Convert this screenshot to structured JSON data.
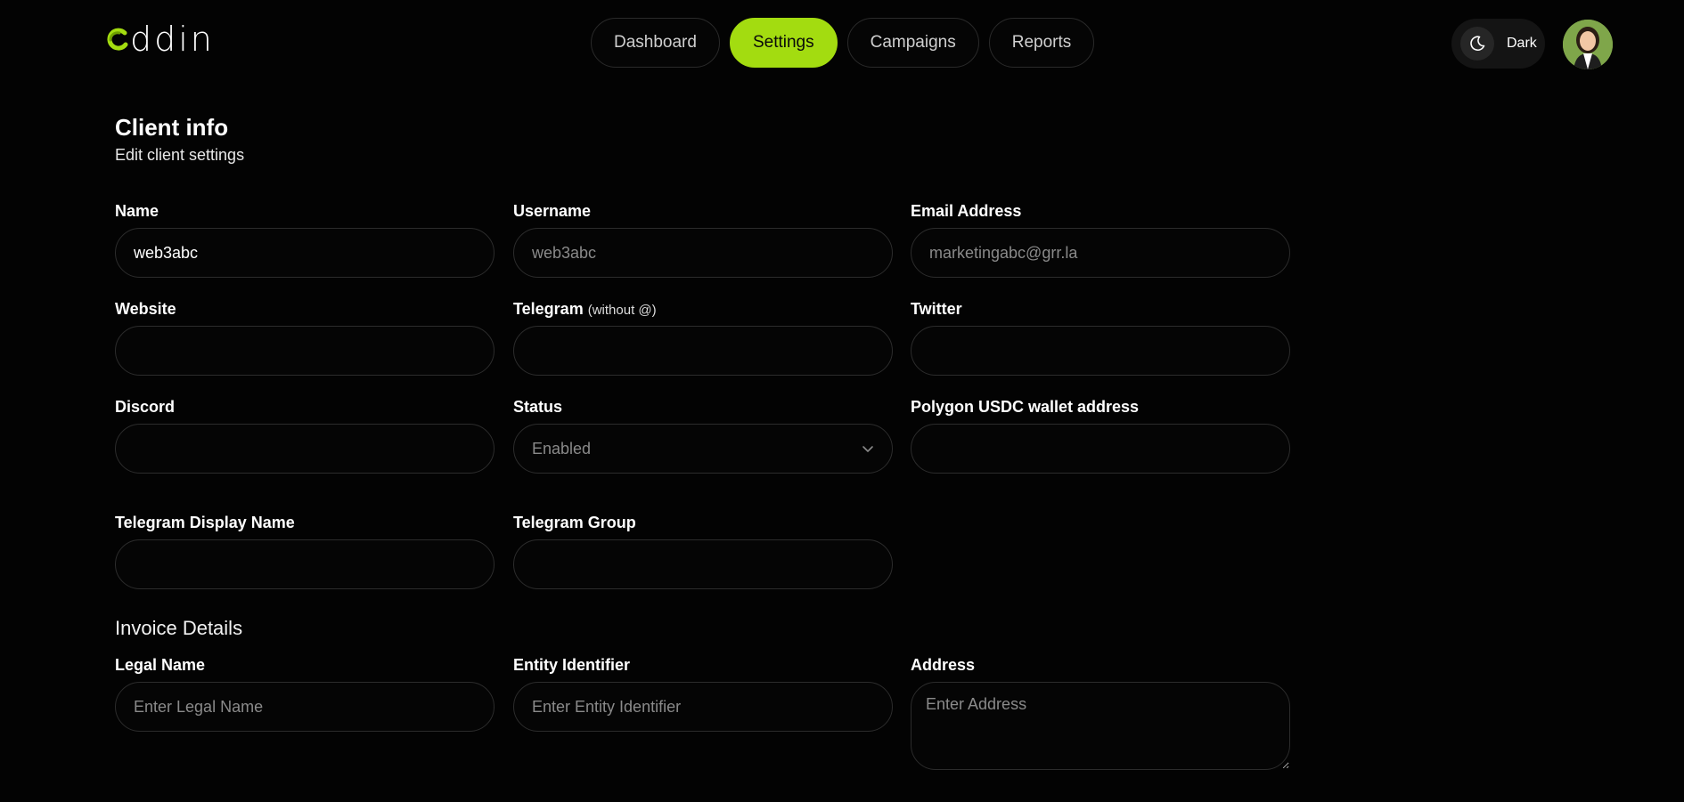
{
  "header": {
    "logo_text": "ddin",
    "nav": [
      {
        "label": "Dashboard",
        "active": false
      },
      {
        "label": "Settings",
        "active": true
      },
      {
        "label": "Campaigns",
        "active": false
      },
      {
        "label": "Reports",
        "active": false
      }
    ],
    "theme_label": "Dark",
    "theme_icon": "moon-icon",
    "accent_color": "#a3dc10"
  },
  "page": {
    "title": "Client info",
    "subtitle": "Edit client settings"
  },
  "fields": {
    "name": {
      "label": "Name",
      "value": "web3abc"
    },
    "username": {
      "label": "Username",
      "value": "web3abc"
    },
    "email": {
      "label": "Email Address",
      "value": "marketingabc@grr.la"
    },
    "website": {
      "label": "Website",
      "value": ""
    },
    "telegram": {
      "label": "Telegram",
      "note": "(without @)",
      "value": ""
    },
    "twitter": {
      "label": "Twitter",
      "value": ""
    },
    "discord": {
      "label": "Discord",
      "value": ""
    },
    "status": {
      "label": "Status",
      "value": "Enabled"
    },
    "wallet": {
      "label": "Polygon USDC wallet address",
      "value": ""
    },
    "telegram_display": {
      "label": "Telegram Display Name",
      "value": ""
    },
    "telegram_group": {
      "label": "Telegram Group",
      "value": ""
    }
  },
  "invoice": {
    "title": "Invoice Details",
    "legal_name": {
      "label": "Legal Name",
      "placeholder": "Enter Legal Name",
      "value": ""
    },
    "entity_id": {
      "label": "Entity Identifier",
      "placeholder": "Enter Entity Identifier",
      "value": ""
    },
    "address": {
      "label": "Address",
      "placeholder": "Enter Address",
      "value": ""
    }
  }
}
